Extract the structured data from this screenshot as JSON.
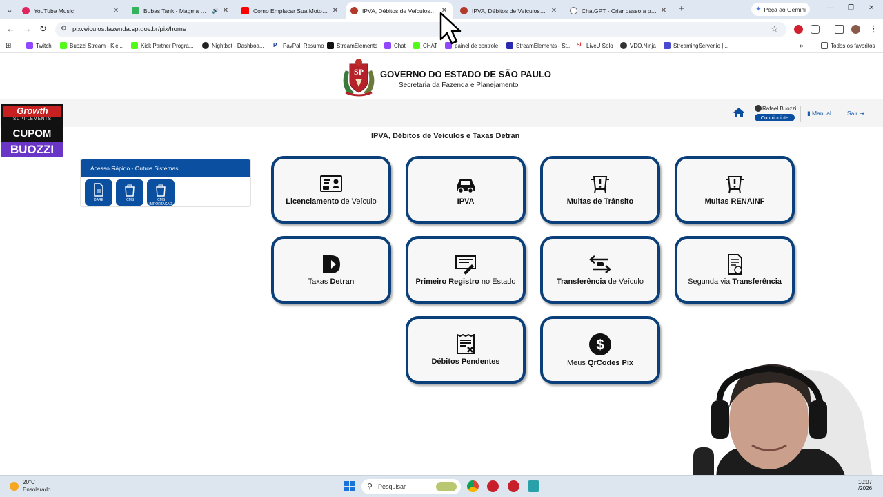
{
  "browser": {
    "tabs": [
      {
        "title": "YouTube Music",
        "color": "#e0245e"
      },
      {
        "title": "Bubas Tank - Magma Crawl",
        "color": "#35b35a"
      },
      {
        "title": "Como Emplacar Sua Moto, Pas",
        "color": "#ff0000"
      },
      {
        "title": "IPVA, Débitos de Veículos e Tax",
        "color": "#b33a2a"
      },
      {
        "title": "IPVA, Débitos de Veículos e Tax",
        "color": "#b33a2a"
      },
      {
        "title": "ChatGPT - Criar passo a passo",
        "color": "#777777"
      }
    ],
    "gemini_label": "Peça ao Gemini",
    "url": "pixveiculos.fazenda.sp.gov.br/pix/home",
    "bookmarks": [
      "Twitch",
      "Buozzi Stream - Kic...",
      "Kick Partner Progra...",
      "Nightbot - Dashboa...",
      "PayPal: Resumo",
      "StreamElements",
      "Chat",
      "CHAT",
      "painel de controle",
      "StreamElements - St...",
      "LiveU Solo",
      "VDO.Ninja",
      "StreamingServer.io |..."
    ],
    "all_favorites": "Todos os favoritos"
  },
  "header": {
    "title": "GOVERNO DO ESTADO DE SÃO PAULO",
    "subtitle": "Secretaria da Fazenda e Planejamento",
    "crest_text": "SP"
  },
  "userbar": {
    "user_name": "Rafael Buozzi",
    "role": "Contribuinte",
    "manual": "Manual",
    "logout": "Sair"
  },
  "promo": {
    "brand": "Growth",
    "tagline": "SUPPLEMENTS",
    "coupon": "CUPOM",
    "code": "BUOZZI"
  },
  "page_title": "IPVA, Débitos de Veículos e Taxas Detran",
  "quick_access": {
    "title": "Acesso Rápido - Outros Sistemas",
    "items": [
      "DARE",
      "ICMS",
      "ICMS IMPORTAÇÃO"
    ]
  },
  "cards": [
    {
      "bold": "Licenciamento",
      "rest": " de Veículo",
      "icon": "license-icon"
    },
    {
      "bold": "IPVA",
      "rest": "",
      "icon": "car-icon"
    },
    {
      "bold": "Multas de Trânsito",
      "rest": "",
      "icon": "traffic-fine-icon"
    },
    {
      "bold": "Multas RENAINF",
      "rest": "",
      "icon": "renainf-fine-icon"
    },
    {
      "pre": "Taxas ",
      "bold": "Detran",
      "rest": "",
      "icon": "detran-icon"
    },
    {
      "bold": "Primeiro Registro",
      "rest": " no Estado",
      "icon": "registration-icon"
    },
    {
      "bold": "Transferência",
      "rest": " de Veículo",
      "icon": "transfer-icon"
    },
    {
      "pre": "Segunda via ",
      "bold": "Transferência",
      "rest": "",
      "icon": "second-copy-icon"
    },
    {
      "bold": "Débitos Pendentes",
      "rest": "",
      "icon": "pending-debts-icon"
    },
    {
      "pre": "Meus ",
      "bold": "QrCodes Pix",
      "rest": "",
      "icon": "dollar-icon"
    }
  ],
  "taskbar": {
    "temperature": "20°C",
    "weather": "Ensolarado",
    "search_placeholder": "Pesquisar",
    "time": "10:07",
    "date": "/2026"
  }
}
